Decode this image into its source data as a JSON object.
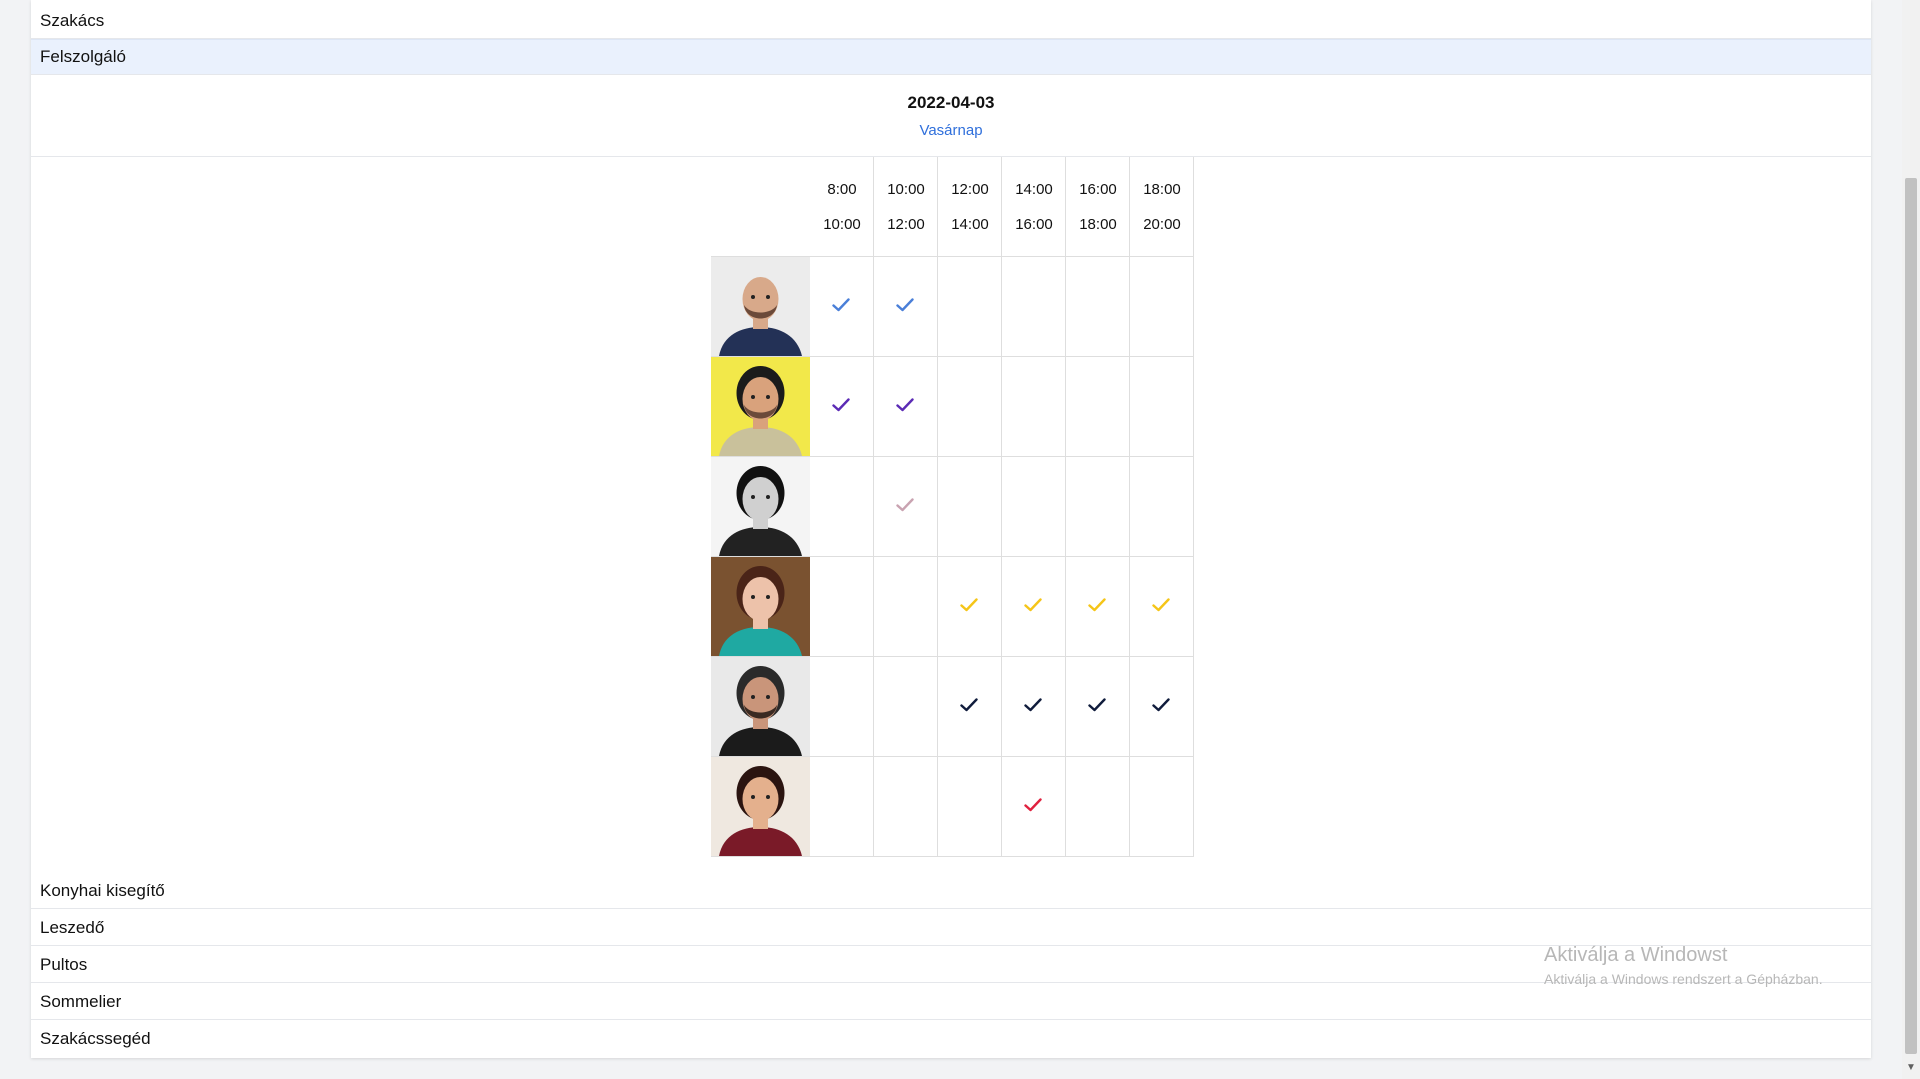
{
  "roles_top": [
    {
      "label": "Szakács",
      "active": false
    },
    {
      "label": "Felszolgáló",
      "active": true
    }
  ],
  "schedule": {
    "date": "2022-04-03",
    "day": "Vasárnap",
    "slots": [
      {
        "start": "8:00",
        "end": "10:00"
      },
      {
        "start": "10:00",
        "end": "12:00"
      },
      {
        "start": "12:00",
        "end": "14:00"
      },
      {
        "start": "14:00",
        "end": "16:00"
      },
      {
        "start": "16:00",
        "end": "18:00"
      },
      {
        "start": "18:00",
        "end": "20:00"
      }
    ],
    "staff": [
      {
        "avatar": "bald-man-avatar",
        "color": "#4a7fd8",
        "shifts": [
          true,
          true,
          false,
          false,
          false,
          false
        ]
      },
      {
        "avatar": "man-yellow-background-avatar",
        "color": "#5b2bb5",
        "shifts": [
          true,
          true,
          false,
          false,
          false,
          false
        ]
      },
      {
        "avatar": "woman-beanie-glasses-avatar",
        "color": "#c9a3b1",
        "shifts": [
          false,
          true,
          false,
          false,
          false,
          false
        ]
      },
      {
        "avatar": "woman-brown-hair-avatar",
        "color": "#f5c518",
        "shifts": [
          false,
          false,
          true,
          true,
          true,
          true
        ]
      },
      {
        "avatar": "man-sunglasses-avatar",
        "color": "#101c3c",
        "shifts": [
          false,
          false,
          true,
          true,
          true,
          true
        ]
      },
      {
        "avatar": "woman-smiling-avatar",
        "color": "#e0213f",
        "shifts": [
          false,
          false,
          false,
          true,
          false,
          false
        ]
      }
    ]
  },
  "roles_bottom": [
    {
      "label": "Konyhai kisegítő"
    },
    {
      "label": "Leszedő"
    },
    {
      "label": "Pultos"
    },
    {
      "label": "Sommelier"
    },
    {
      "label": "Szakácssegéd"
    }
  ],
  "watermark": {
    "title": "Aktiválja a Windowst",
    "subtitle": "Aktiválja a Windows rendszert a Gépházban."
  }
}
